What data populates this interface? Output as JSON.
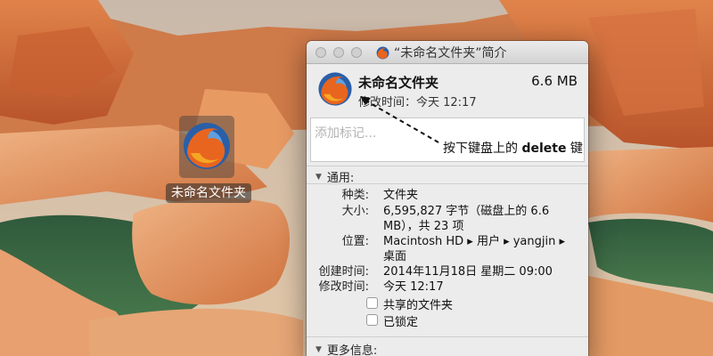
{
  "desktop": {
    "file_name": "未命名文件夹",
    "icon": "firefox-icon"
  },
  "window": {
    "title": "“未命名文件夹”简介",
    "file_name": "未命名文件夹",
    "file_size": "6.6 MB",
    "modified_label": "修改时间：今天 12:17",
    "tags_placeholder": "添加标记...",
    "general": {
      "header": "通用:",
      "kind_label": "种类:",
      "kind_value": "文件夹",
      "size_label": "大小:",
      "size_value_line1": "6,595,827 字节（磁盘上的 6.6",
      "size_value_line2": "MB），共 23 项",
      "where_label": "位置:",
      "where_value_line1": "Macintosh HD ▸ 用户 ▸ yangjin ▸",
      "where_value_line2": "桌面",
      "created_label": "创建时间:",
      "created_value": "2014年11月18日 星期二 09:00",
      "modified_label": "修改时间:",
      "modified_value": "今天 12:17",
      "shared_label": "共享的文件夹",
      "locked_label": "已锁定"
    },
    "more_info_header": "更多信息:"
  },
  "annotation": {
    "text_prefix": "按下键盘上的 ",
    "text_key": "delete",
    "text_suffix": " 键"
  },
  "colors": {
    "window_bg": "#ececec",
    "titlebar_bg": "#d9d9d9"
  }
}
